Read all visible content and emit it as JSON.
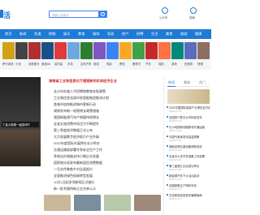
{
  "header": {
    "logo_text": "活",
    "search_placeholder": "请输入关键词",
    "icons": [
      {
        "label": "公众号",
        "icon": "wechat-icon"
      },
      {
        "label": "投稿",
        "icon": "edit-icon"
      }
    ]
  },
  "nav": {
    "items": [
      "首页",
      "新闻",
      "交通",
      "购物",
      "娱乐",
      "教育",
      "服饰",
      "家居",
      "房产",
      "招聘",
      "生活",
      "美食",
      "旅游",
      "健康"
    ]
  },
  "tiles": [
    {
      "caption": "萨尔游戏"
    },
    {
      "caption": "小米"
    },
    {
      "caption": "全新宝马"
    },
    {
      "caption": "奥迪A6"
    },
    {
      "caption": "高乐高"
    },
    {
      "caption": "手机"
    },
    {
      "caption": "吉利汽车"
    },
    {
      "caption": "旅游"
    },
    {
      "caption": "电影"
    },
    {
      "caption": "餐饮"
    },
    {
      "caption": "爱奇艺"
    },
    {
      "caption": "汽车"
    },
    {
      "caption": "保险"
    },
    {
      "caption": "游戏"
    },
    {
      "caption": "优惠券"
    },
    {
      "caption": "快递"
    }
  ],
  "banner": {
    "caption": "丁奚小镇第一届游戏节"
  },
  "news": {
    "headline": "湖南省工业和信息化厅通报新的实体经济企业",
    "items": [
      "长沙市实施人才招聘和教育补贴政策",
      "工业和信息化部印发智能制造推进计划",
      "各城市加快推进城市更新行动",
      "湖南发布新一轮稳增长政策措施",
      "我国新能源汽车产销量持续增长",
      "全省文旅消费市场活力不断提升",
      "第三季度经济数据正式公布",
      "大力发展数字经济助力产业升级",
      "2022年度国际车展将在长沙举办",
      "交通运输部部署冬季安全生产工作",
      "多地出台措施支持小微企业发展",
      "国家统计局发布最新居民消费数据",
      "一号文件聚焦乡村全面振兴",
      "全面推进绿色低碳转型发展",
      "10月1日起多项新规正式施行",
      "新一批专精特新企业名单公示"
    ]
  },
  "right": {
    "tabs": [
      "快讯",
      "最新",
      "热门"
    ],
    "items": [
      {
        "title": "2022中国国际智能产业博览会开幕",
        "date": "2022-07-19"
      },
      {
        "title": "全国首个数字乡村标准发布",
        "date": "2022-07-19"
      },
      {
        "title": "长沙地铁新线路即将开通运营",
        "date": "2022-07-19"
      },
      {
        "title": "中国气象局发布高温预警",
        "date": "2022-07-18"
      },
      {
        "title": "湖南自贸区建设取得新成效",
        "date": "2022-07-18"
      },
      {
        "title": "全省中小学开学准备工作部署",
        "date": "2022-07-18"
      },
      {
        "title": "第三届湘江论坛成功举办",
        "date": "2022-07-18"
      },
      {
        "title": "新能源汽车下乡活动启动",
        "date": "2022-07-18"
      },
      {
        "title": "全国夏粮生产再获丰收",
        "date": "2022-07-17"
      },
      {
        "title": "文化和旅游部发布暑期指南",
        "date": "2022-07-17"
      }
    ]
  },
  "colors": {
    "primary": "#1d7bd6",
    "accent": "#d42b2b"
  }
}
